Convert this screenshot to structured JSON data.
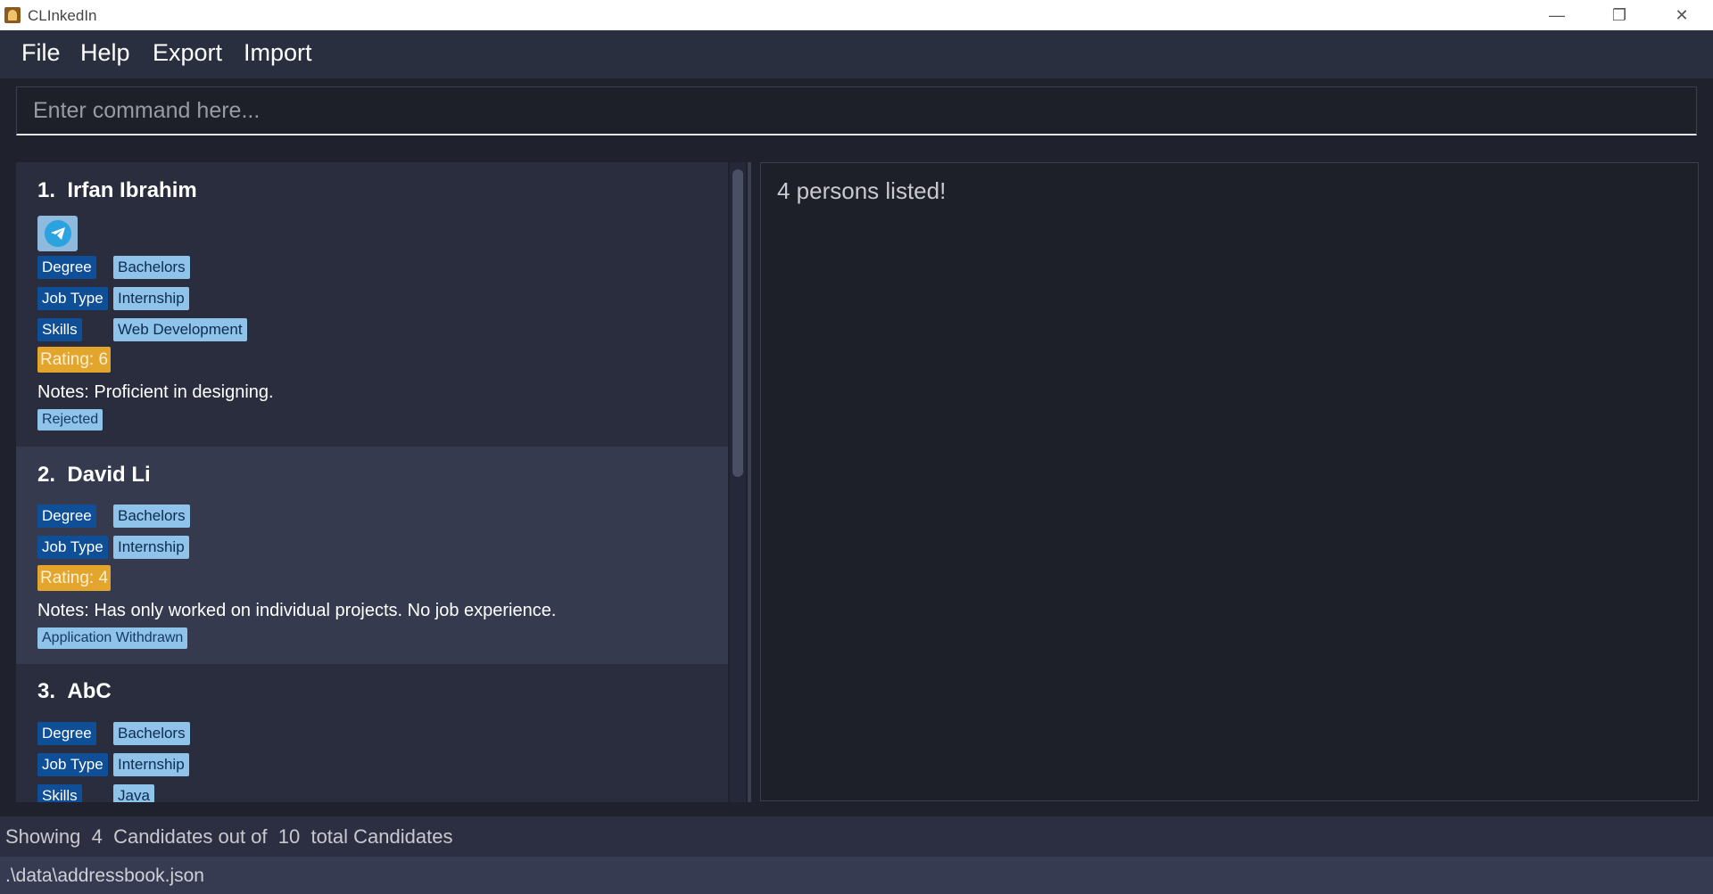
{
  "window": {
    "title": "CLInkedIn",
    "minimize": "—",
    "maximize": "❐",
    "close": "✕"
  },
  "menu": [
    "File",
    "Help",
    "Export",
    "Import"
  ],
  "command": {
    "placeholder": "Enter command here..."
  },
  "persons": [
    {
      "index": "1.",
      "name": "Irfan Ibrahim",
      "has_telegram": true,
      "degree_key": "Degree",
      "degree_val": "Bachelors",
      "job_key": "Job Type",
      "job_val": "Internship",
      "skills_key": "Skills",
      "skills_val": "Web Development",
      "rating": "Rating: 6",
      "notes": "Notes: Proficient in designing.",
      "status": "Rejected"
    },
    {
      "index": "2.",
      "name": "David Li",
      "degree_key": "Degree",
      "degree_val": "Bachelors",
      "job_key": "Job Type",
      "job_val": "Internship",
      "rating": "Rating: 4",
      "notes": "Notes: Has only worked on individual projects. No job experience.",
      "status": "Application Withdrawn"
    },
    {
      "index": "3.",
      "name": "AbC",
      "degree_key": "Degree",
      "degree_val": "Bachelors",
      "job_key": "Job Type",
      "job_val": "Internship",
      "skills_key": "Skills",
      "skills_val": "Java"
    }
  ],
  "result": {
    "text": "4 persons listed!"
  },
  "footer": {
    "showing": "Showing  4  Candidates out of  10  total Candidates",
    "path": ".\\data\\addressbook.json"
  },
  "colors": {
    "tag_dark": "#0e4f98",
    "tag_light": "#8fc3ea",
    "rating": "#e3a52b"
  }
}
